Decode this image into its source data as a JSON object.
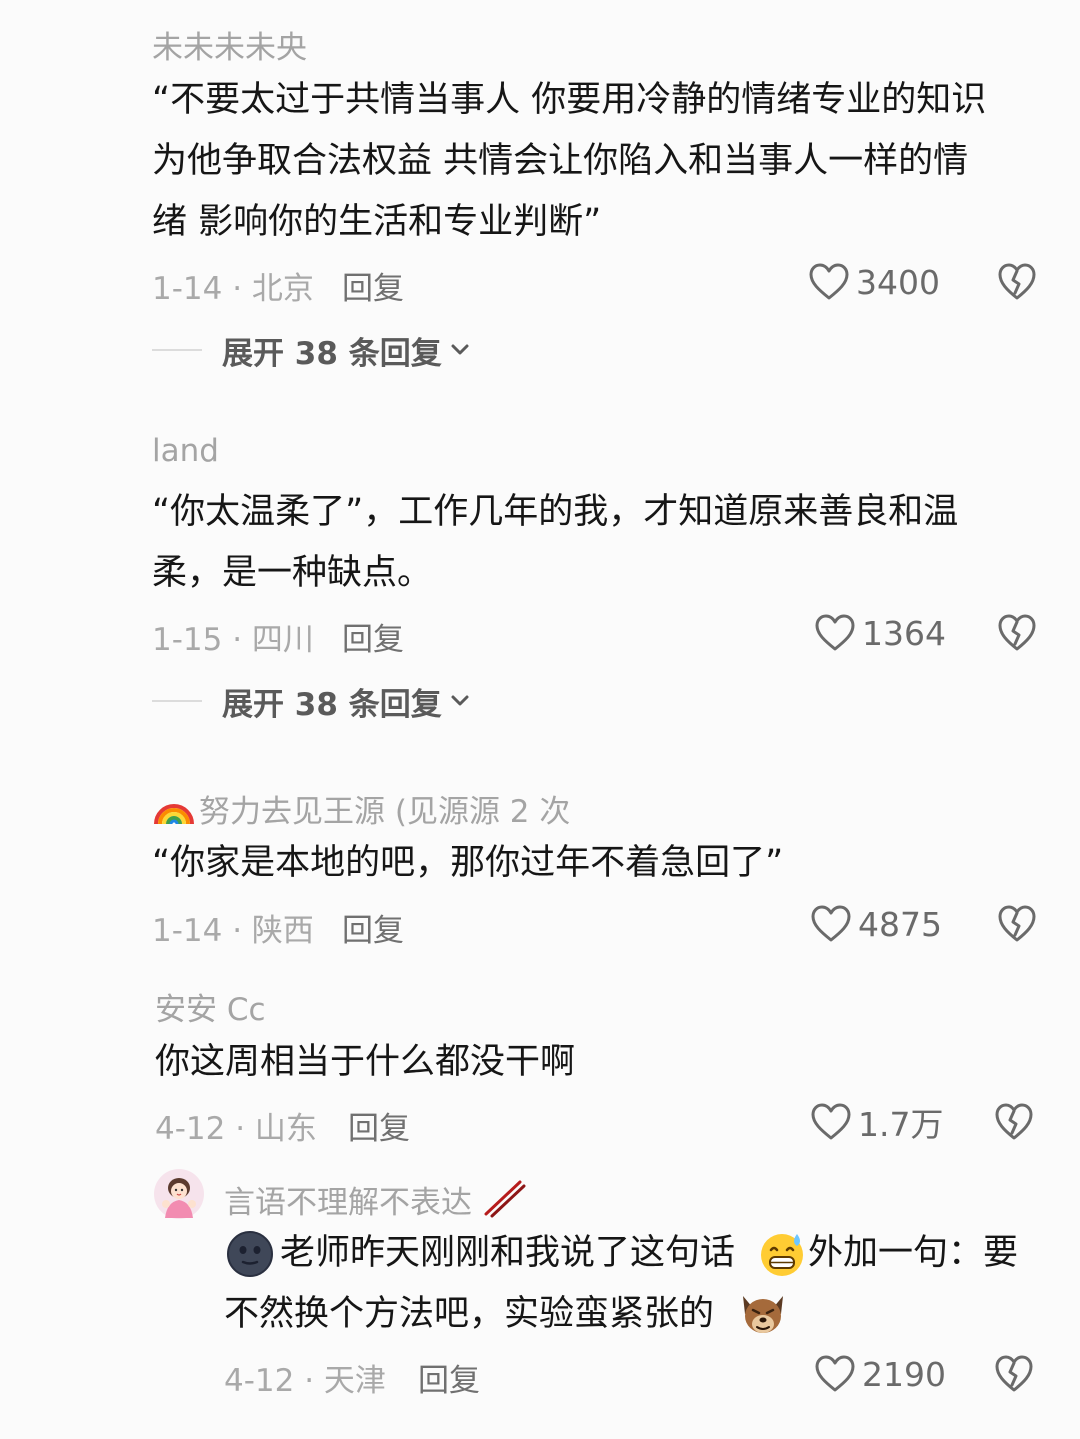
{
  "comments": [
    {
      "username": "未未未未央",
      "lines": [
        "“不要太过于共情当事人 你要用冷静的情绪专业的知识",
        "为他争取合法权益 共情会让你陷入和当事人一样的情",
        "绪 影响你的生活和专业判断”"
      ],
      "date_location": "1-14 · 北京",
      "reply_label": "回复",
      "likes": "3400",
      "expand_label": "展开 38 条回复"
    },
    {
      "username": "land",
      "lines": [
        "“你太温柔了”，工作几年的我，才知道原来善良和温",
        "柔，是一种缺点。"
      ],
      "date_location": "1-15 · 四川",
      "reply_label": "回复",
      "likes": "1364",
      "expand_label": "展开 38 条回复"
    },
    {
      "username": "努力去见王源 (见源源 2 次",
      "username_icon": "rainbow-icon",
      "lines": [
        "“你家是本地的吧，那你过年不着急回了”"
      ],
      "date_location": "1-14 · 陕西",
      "reply_label": "回复",
      "likes": "4875"
    },
    {
      "username": "安安 Cc",
      "lines": [
        "你这周相当于什么都没干啊"
      ],
      "date_location": "4-12 · 山东",
      "reply_label": "回复",
      "likes": "1.7万"
    },
    {
      "username": "言语不理解不表达",
      "username_icon": "chopsticks-icon",
      "avatar": "avatar-icon",
      "lines": [
        "老师昨天刚刚和我说了这句话",
        "外加一句：要",
        "不然换个方法吧，实验蛮紧张的"
      ],
      "emojis": [
        "dark-face-emoji",
        "sweat-grin-emoji",
        "dog-emoji"
      ],
      "date_location": "4-12 · 天津",
      "reply_label": "回复",
      "likes": "2190"
    }
  ],
  "colors": {
    "background": "#fbfbfb",
    "username": "#a4a4a4",
    "content": "#161616",
    "meta": "#a9a9a9",
    "icon": "#6a6a6a"
  }
}
